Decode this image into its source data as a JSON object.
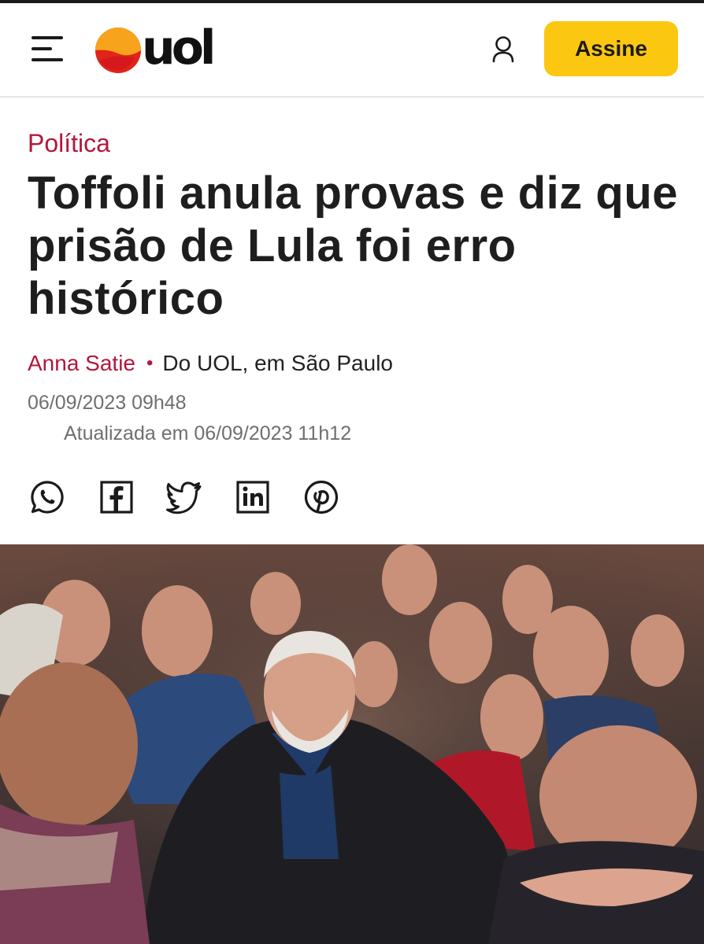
{
  "header": {
    "logo_text": "uol",
    "subscribe_label": "Assine",
    "icons": [
      "menu-icon",
      "user-icon"
    ]
  },
  "article": {
    "section": "Política",
    "headline": "Toffoli anula provas e diz que prisão de Lula foi erro histórico",
    "author": "Anna Satie",
    "byline_separator": "•",
    "source": "Do UOL, em São Paulo",
    "published": "06/09/2023 09h48",
    "updated": "Atualizada em 06/09/2023 11h12"
  },
  "share": {
    "icons": [
      "whatsapp-icon",
      "facebook-icon",
      "twitter-icon",
      "linkedin-icon",
      "pinterest-icon"
    ]
  },
  "colors": {
    "accent": "#b5163a",
    "subscribe": "#fcc710",
    "logo_orange": "#f7a31c",
    "logo_red": "#e2231a"
  }
}
